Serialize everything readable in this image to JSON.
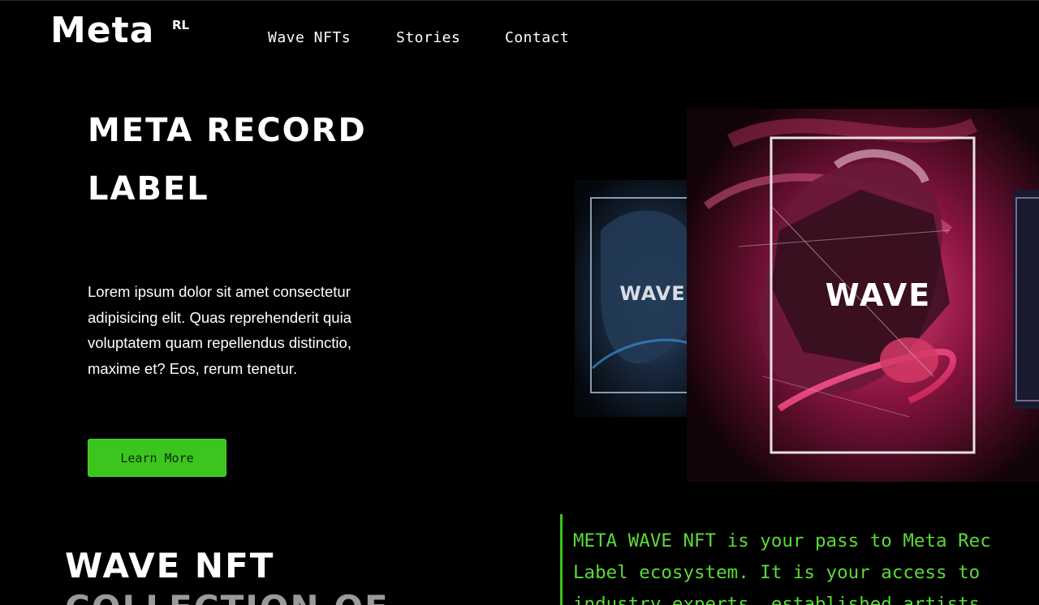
{
  "header": {
    "logo": "Meta",
    "logo_sup": "RL",
    "nav": [
      "Wave NFTs",
      "Stories",
      "Contact"
    ]
  },
  "hero": {
    "title_line1": "META RECORD",
    "title_line2": "LABEL",
    "description": "Lorem ipsum dolor sit amet consectetur adipisicing elit. Quas reprehenderit quia voluptatem quam repellendus distinctio, maxime et? Eos, rerum tenetur.",
    "button_label": "Learn More",
    "art_label_left": "WAVE",
    "art_label_center": "WAVE"
  },
  "section2": {
    "title_line1": "WAVE NFT",
    "title_line2": "COLLECTION OF",
    "body_lines": [
      "META WAVE NFT is your pass to Meta Rec",
      "Label ecosystem. It is your access to",
      "industry experts, established artists"
    ]
  },
  "colors": {
    "background": "#000000",
    "accent_green": "#3cc51e",
    "text_green": "#5bd93a",
    "card_magenta": "#c81e5a",
    "card_blue": "#2a4a6a"
  }
}
